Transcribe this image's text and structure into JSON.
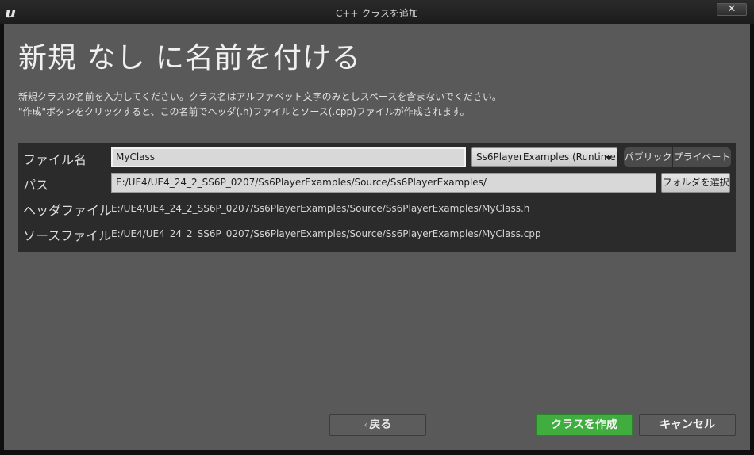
{
  "window": {
    "title": "C++ クラスを追加",
    "close_glyph": "✕",
    "logo_glyph": "u"
  },
  "page": {
    "heading": "新規 なし に名前を付ける",
    "desc_line1": "新規クラスの名前を入力してください。クラス名はアルファベット文字のみとしスペースを含まないでください。",
    "desc_line2": "\"作成\"ボタンをクリックすると、この名前でヘッダ(.h)ファイルとソース(.cpp)ファイルが作成されます。"
  },
  "form": {
    "name_label": "ファイル名",
    "name_value": "MyClass",
    "module_value": "Ss6PlayerExamples (Runtime)",
    "public_label": "パブリック",
    "private_label": "プライベート",
    "path_label": "パス",
    "path_value": "E:/UE4/UE4_24_2_SS6P_0207/Ss6PlayerExamples/Source/Ss6PlayerExamples/",
    "choose_folder_label": "フォルダを選択",
    "header_label": "ヘッダファイル",
    "header_value": "E:/UE4/UE4_24_2_SS6P_0207/Ss6PlayerExamples/Source/Ss6PlayerExamples/MyClass.h",
    "source_label": "ソースファイル",
    "source_value": "E:/UE4/UE4_24_2_SS6P_0207/Ss6PlayerExamples/Source/Ss6PlayerExamples/MyClass.cpp"
  },
  "footer": {
    "back_label": "戻る",
    "create_label": "クラスを作成",
    "cancel_label": "キャンセル"
  },
  "colors": {
    "create_button": "#3fae3f",
    "content_background": "#595959",
    "panel_background": "#2b2b2b"
  }
}
